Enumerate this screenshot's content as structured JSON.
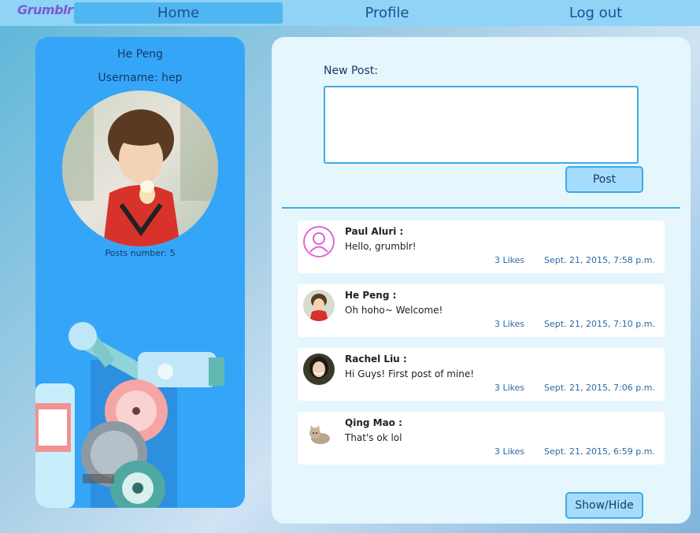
{
  "nav": {
    "logo": "Grumblr",
    "home": "Home",
    "profile": "Profile",
    "logout": "Log out"
  },
  "profile": {
    "name": "He Peng",
    "username": "Username: hep",
    "posts_count": "Posts number: 5"
  },
  "composer": {
    "label": "New Post:",
    "value": "",
    "placeholder": "",
    "post_button": "Post"
  },
  "feed": [
    {
      "author": "Paul Aluri :",
      "text": "Hello, grumblr!",
      "likes": "3 Likes",
      "time": "Sept. 21, 2015, 7:58 p.m.",
      "avatar_icon": "default-user-icon"
    },
    {
      "author": "He Peng :",
      "text": "Oh hoho~ Welcome!",
      "likes": "3 Likes",
      "time": "Sept. 21, 2015, 7:10 p.m.",
      "avatar_icon": "child-photo"
    },
    {
      "author": "Rachel Liu :",
      "text": "Hi Guys! First post of mine!",
      "likes": "3 Likes",
      "time": "Sept. 21, 2015, 7:06 p.m.",
      "avatar_icon": "woman-photo"
    },
    {
      "author": "Qing Mao :",
      "text": "That's ok lol",
      "likes": "3 Likes",
      "time": "Sept. 21, 2015, 6:59 p.m.",
      "avatar_icon": "cat-photo"
    }
  ],
  "show_hide_button": "Show/Hide",
  "colors": {
    "nav_bg": "#8fd3f7",
    "nav_active": "#4fb6f2",
    "profile_bg": "#35a5f7",
    "panel_bg": "#e5f6fd",
    "accent": "#3fa9e6",
    "link": "#2a6aa8"
  }
}
